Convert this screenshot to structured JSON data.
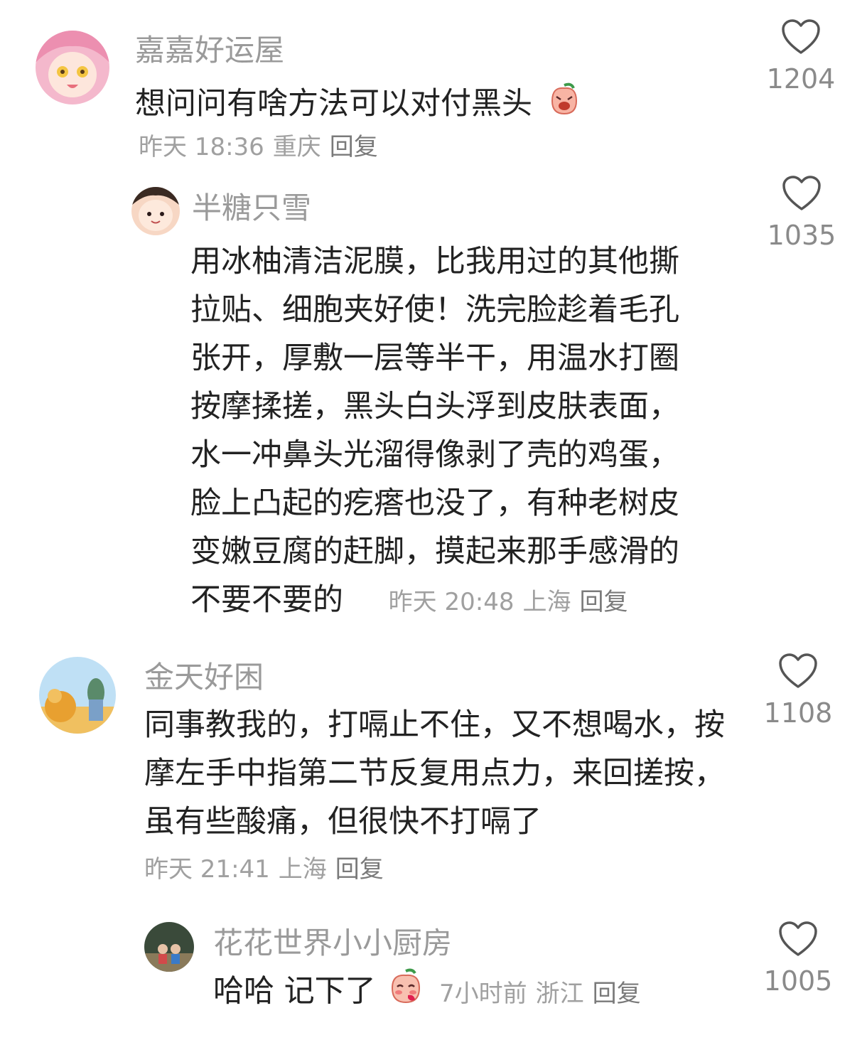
{
  "comments": [
    {
      "username": "嘉嘉好运屋",
      "text": "想问问有啥方法可以对付黑头",
      "time": "昨天 18:36",
      "location": "重庆",
      "reply": "回复",
      "likes": "1204",
      "emoji": "crying-peach-emoji"
    },
    {
      "username": "半糖只雪",
      "lines": [
        "用冰柚清洁泥膜，比我用过的其他撕",
        "拉贴、细胞夹好使！洗完脸趁着毛孔",
        "张开，厚敷一层等半干，用温水打圈",
        "按摩揉搓，黑头白头浮到皮肤表面，",
        "水一冲鼻头光溜得像剥了壳的鸡蛋，",
        "脸上凸起的疙瘩也没了，有种老树皮",
        "变嫩豆腐的赶脚，摸起来那手感滑的",
        "不要不要的"
      ],
      "time": "昨天 20:48",
      "location": "上海",
      "reply": "回复",
      "likes": "1035"
    },
    {
      "username": "金天好困",
      "lines": [
        "同事教我的，打嗝止不住，又不想喝水，按",
        "摩左手中指第二节反复用点力，来回搓按，",
        "虽有些酸痛，但很快不打嗝了"
      ],
      "time": "昨天 21:41",
      "location": "上海",
      "reply": "回复",
      "likes": "1108"
    },
    {
      "username": "花花世界小小厨房",
      "text": "哈哈 记下了",
      "time": "7小时前",
      "location": "浙江",
      "reply": "回复",
      "likes": "1005",
      "emoji": "blushing-peach-emoji"
    }
  ],
  "icons": {
    "like": "heart-outline-icon"
  },
  "colors": {
    "username": "#9a9a9a",
    "text": "#222222",
    "meta": "#a0a0a0"
  }
}
